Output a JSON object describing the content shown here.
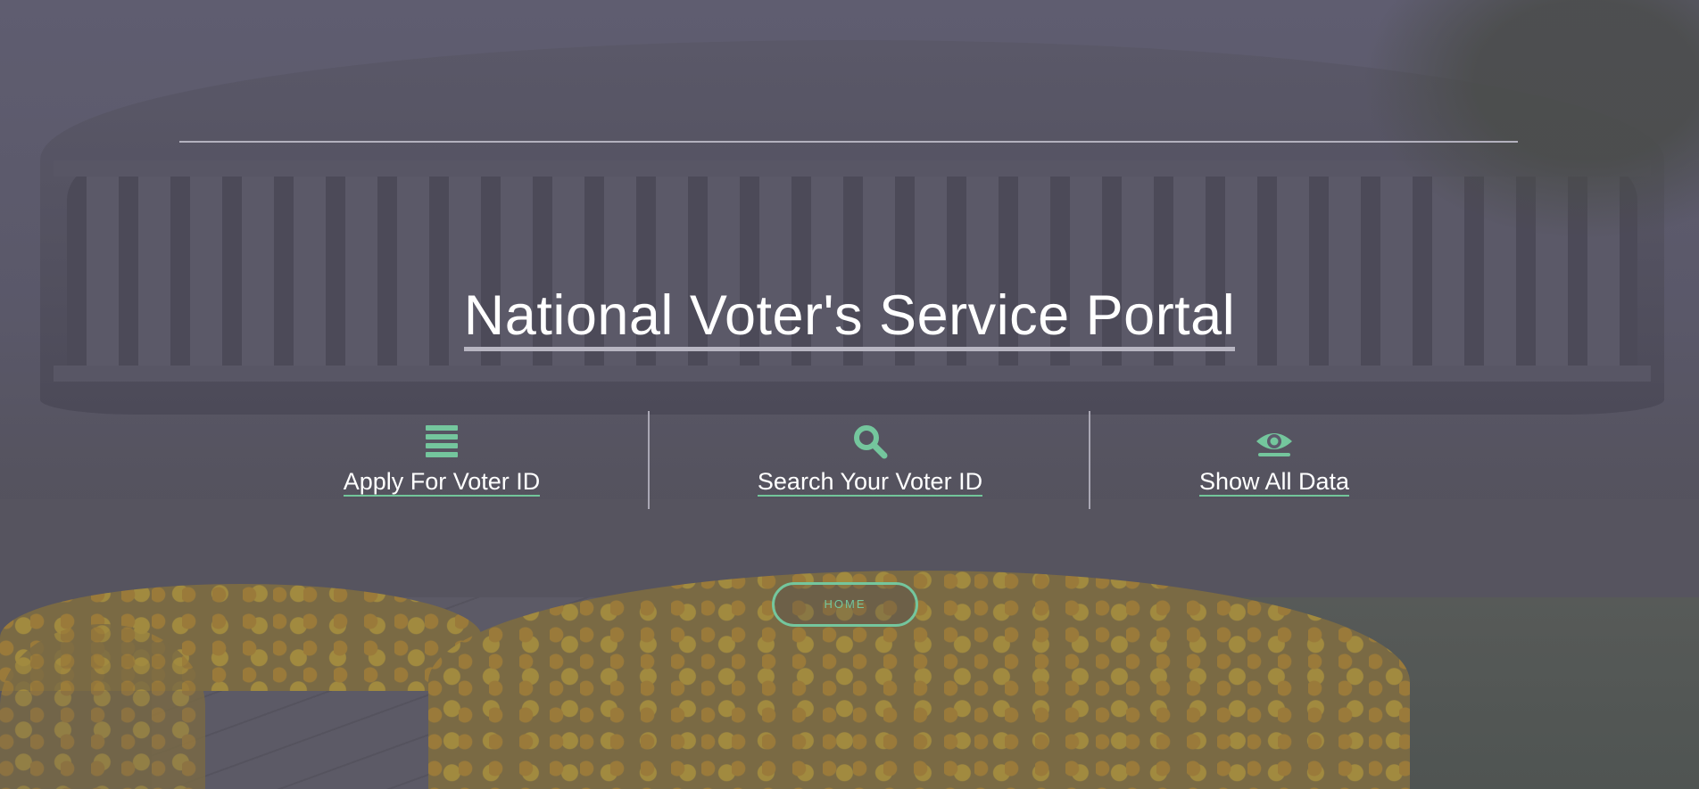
{
  "hero": {
    "title": "National Voter's Service Portal"
  },
  "features": [
    {
      "icon": "list-icon",
      "label": "Apply For Voter ID"
    },
    {
      "icon": "search-icon",
      "label": "Search Your Voter ID"
    },
    {
      "icon": "eye-icon",
      "label": "Show All Data"
    }
  ],
  "home_button": {
    "label": "HOME"
  },
  "colors": {
    "accent": "#74c69d",
    "overlay": "#5c5a6c",
    "text": "#ffffff"
  }
}
